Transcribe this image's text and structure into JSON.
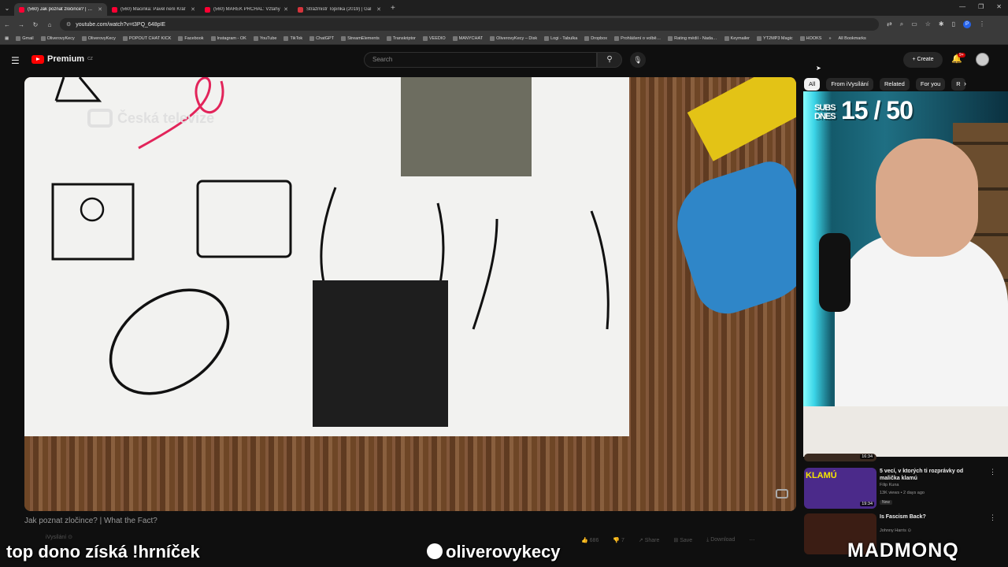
{
  "browser": {
    "tabs": [
      {
        "title": "(560) Jak poznat zločince? | Wh",
        "active": true
      },
      {
        "title": "(560) Macinka: Pavel není Kráľ",
        "active": false
      },
      {
        "title": "(560) MAREK PRCHAL: Vztahy",
        "active": false
      },
      {
        "title": "Strážmistr Topinka (2019) | Gal",
        "active": false
      }
    ],
    "new_tab": "+",
    "url": "youtube.com/watch?v=t3PQ_648pIE",
    "profile": "P",
    "bookmarks": [
      "Gmail",
      "OliverovyKecy",
      "OliverovyKecy",
      "POPOUT CHAT KICK",
      "Facebook",
      "Instagram - OK",
      "YouTube",
      "TikTok",
      "ChatGPT",
      "StreamElements",
      "Transkriptor",
      "VEEDIO",
      "MANYCHAT",
      "OliverovyKecy – Disk",
      "Logi - Tabulka",
      "Dropbox",
      "Prohlášení o volbě…",
      "Rating médií - Nada…",
      "Keymailer",
      "YT2MP3 Magic",
      "HOOKS"
    ],
    "all_bookmarks": "All Bookmarks"
  },
  "yt": {
    "logo_text": "Premium",
    "logo_sup": "CZ",
    "search_placeholder": "Search",
    "create_label": "+ Create",
    "notif_count": "9+"
  },
  "player": {
    "watermark": "Česká televize"
  },
  "video": {
    "title": "Jak poznat zločince? | What the Fact?",
    "channel": "iVysílání ⊙",
    "actions": [
      "👍 686",
      "👎 7",
      "↗ Share",
      "⊞ Save",
      "⤓ Download",
      "⋯"
    ]
  },
  "sidebar": {
    "chips": [
      "All",
      "From iVysílání",
      "Related",
      "For you",
      "R"
    ],
    "stream_overlay": {
      "subs_label": "SUBS DNES",
      "subs_value": "15 / 50"
    },
    "recommendations": [
      {
        "title": "5 vecí, v ktorých ti rozprávky od malička klamú",
        "channel": "Filip Kuna",
        "views": "13K views • 2 days ago",
        "badge": "New",
        "duration": "19:34",
        "thumb_text": "KLAMÚ"
      },
      {
        "title": "Is Fascism Back?",
        "channel": "Johnny Harris ⊙",
        "views": "",
        "badge": "",
        "duration": "",
        "thumb_text": ""
      }
    ],
    "partial_duration": "16:34"
  },
  "stream_text": {
    "left": "top dono získá !hrníček",
    "center": "oliverovykecy",
    "right": "MADMONQ"
  }
}
